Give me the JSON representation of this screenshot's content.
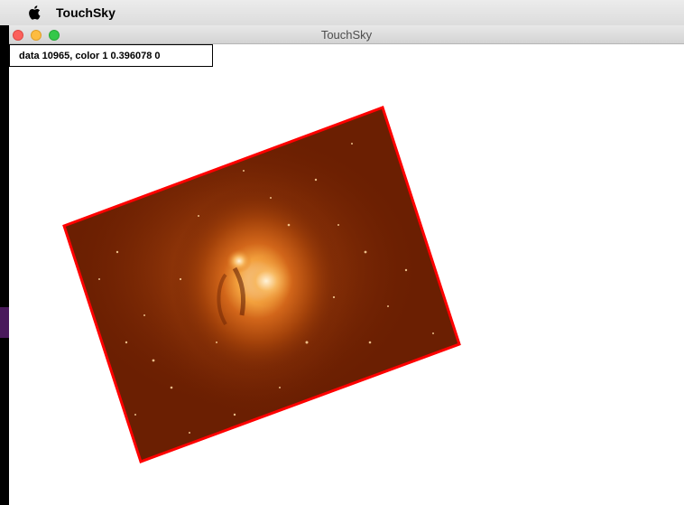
{
  "menubar": {
    "apple_icon": "apple-icon",
    "app_name": "TouchSky"
  },
  "window": {
    "title": "TouchSky",
    "controls": [
      "close",
      "minimize",
      "zoom"
    ]
  },
  "readout": {
    "text": "data 10965, color 1 0.396078 0"
  },
  "image": {
    "rotation_deg": -22.5,
    "border_color": "#ff0000",
    "colormap": "heat"
  },
  "colors": {
    "border": "#ff0000",
    "bg_dark": "#6b1f02",
    "nebula_core": "#fff3d8",
    "window_bg": "#ffffff"
  }
}
